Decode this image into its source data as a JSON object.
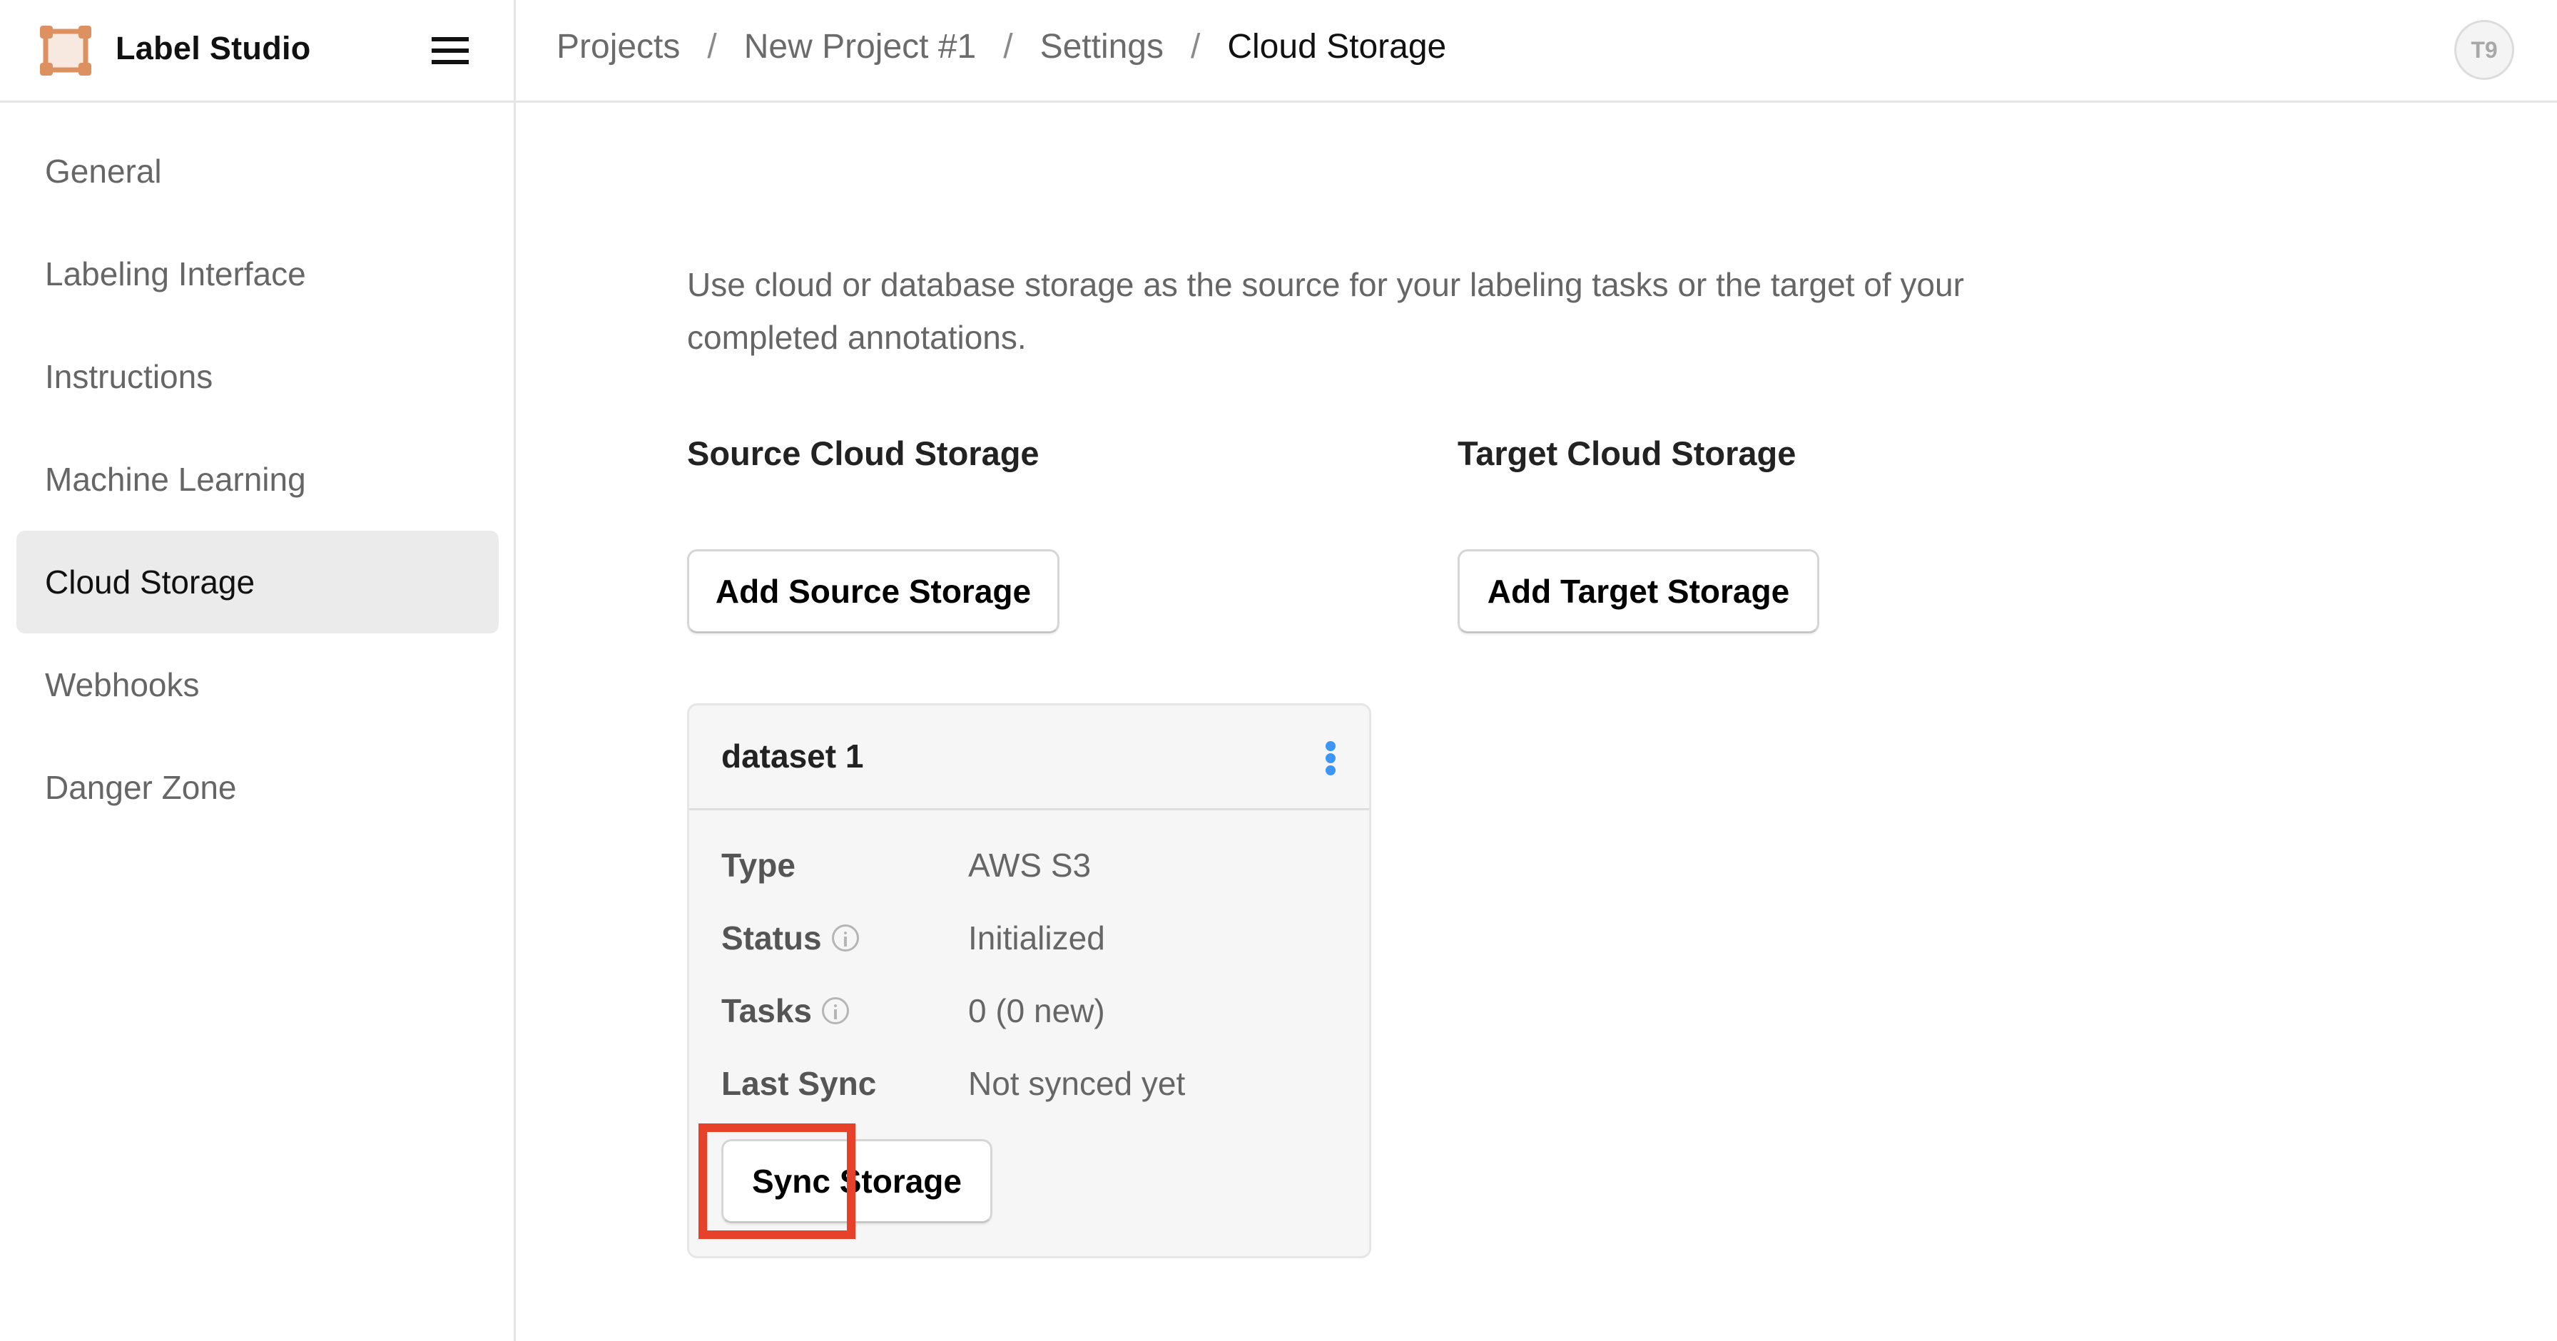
{
  "app": {
    "title": "Label Studio",
    "logo_icon": "label-studio-logo",
    "menu_icon": "hamburger-menu-icon",
    "brand_color": "#de9160",
    "brand_fill": "#f7e9df"
  },
  "breadcrumb": {
    "items": [
      "Projects",
      "New Project #1",
      "Settings",
      "Cloud Storage"
    ],
    "separator": "/"
  },
  "user": {
    "avatar_initials": "T9"
  },
  "sidebar": {
    "items": [
      {
        "label": "General",
        "active": false
      },
      {
        "label": "Labeling Interface",
        "active": false
      },
      {
        "label": "Instructions",
        "active": false
      },
      {
        "label": "Machine Learning",
        "active": false
      },
      {
        "label": "Cloud Storage",
        "active": true
      },
      {
        "label": "Webhooks",
        "active": false
      },
      {
        "label": "Danger Zone",
        "active": false
      }
    ]
  },
  "main": {
    "description": "Use cloud or database storage as the source for your labeling tasks or the target of your completed annotations.",
    "source": {
      "title": "Source Cloud Storage",
      "add_button": "Add Source Storage"
    },
    "target": {
      "title": "Target Cloud Storage",
      "add_button": "Add Target Storage"
    },
    "storage_card": {
      "name": "dataset 1",
      "menu_icon": "kebab-menu-icon",
      "accent_color": "#3d95f5",
      "rows": [
        {
          "label": "Type",
          "value": "AWS S3",
          "info": false
        },
        {
          "label": "Status",
          "value": "Initialized",
          "info": true
        },
        {
          "label": "Tasks",
          "value": "0 (0 new)",
          "info": true
        },
        {
          "label": "Last Sync",
          "value": "Not synced yet",
          "info": false
        }
      ],
      "sync_button": "Sync Storage"
    },
    "highlight_color": "#e8412a"
  }
}
